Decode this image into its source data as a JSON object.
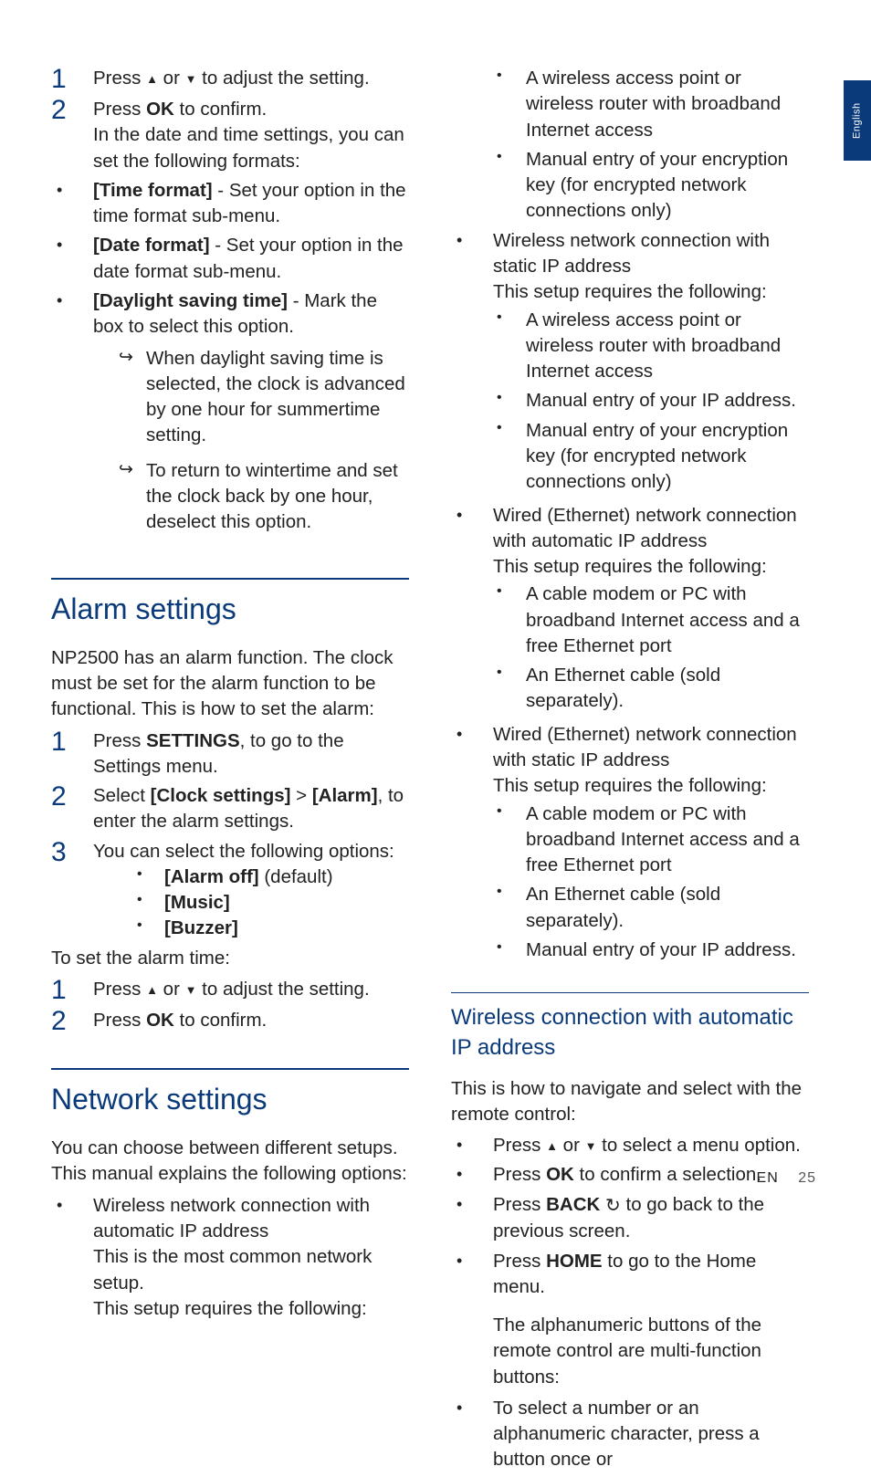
{
  "sideTab": "English",
  "footer": {
    "lang": "EN",
    "page": "25"
  },
  "glyph": {
    "up": "▲",
    "down": "▼",
    "bullet": "•",
    "arrow": "↪",
    "back": "↺"
  },
  "left": {
    "steps1": [
      {
        "n": "1",
        "pre": "Press ",
        "mid": " or ",
        "post": " to adjust the setting."
      },
      {
        "n": "2",
        "pre": "Press ",
        "bold": "OK",
        "post": " to confirm.",
        "extra": "In the date and time settings, you can set the following formats:"
      }
    ],
    "bullets1": [
      {
        "bold": "[Time format]",
        "rest": " - Set your option in the time format sub-menu."
      },
      {
        "bold": "[Date format]",
        "rest": " - Set your option in the date format sub-menu."
      },
      {
        "bold": "[Daylight saving time]",
        "rest": " - Mark the box to select this option.",
        "arrows": [
          "When daylight saving time is selected, the clock is advanced by one hour for summertime setting.",
          "To return to wintertime and set the clock back by one hour, deselect this option."
        ]
      }
    ],
    "alarm": {
      "title": "Alarm settings",
      "intro": "NP2500 has an alarm function. The clock must be set for the alarm function to be functional. This is how to set the alarm:",
      "steps": [
        {
          "n": "1",
          "pre": "Press ",
          "bold": "SETTINGS",
          "post": ", to go to the Settings menu."
        },
        {
          "n": "2",
          "pre": "Select ",
          "bold": "[Clock settings]",
          "mid": " > ",
          "bold2": "[Alarm]",
          "post": ", to enter the alarm settings."
        },
        {
          "n": "3",
          "pre": "You can select the following options:",
          "opts": [
            {
              "b": "[Alarm off]",
              "r": " (default)"
            },
            {
              "b": "[Music]",
              "r": ""
            },
            {
              "b": "[Buzzer]",
              "r": ""
            }
          ]
        }
      ],
      "toset": "To set the alarm time:",
      "steps2": [
        {
          "n": "1",
          "pre": "Press ",
          "mid": " or ",
          "post": " to adjust the setting."
        },
        {
          "n": "2",
          "pre": "Press ",
          "bold": "OK",
          "post": " to confirm."
        }
      ]
    },
    "network": {
      "title": "Network settings",
      "intro": "You can choose between different setups. This manual explains the following options:",
      "item1": {
        "line1": "Wireless network connection with automatic IP address",
        "line2": "This is the most common network setup.",
        "line3": "This setup requires the following:"
      }
    }
  },
  "right": {
    "top_subs": [
      "A wireless access point or wireless router with broadband Internet access",
      "Manual entry of your encryption key (for encrypted network connections only)"
    ],
    "items": [
      {
        "line1": "Wireless network connection with static IP address",
        "req": "This setup requires the following:",
        "subs": [
          "A wireless access point or wireless router with broadband Internet access",
          "Manual entry of your IP address.",
          "Manual entry of your encryption key (for encrypted network connections only)"
        ]
      },
      {
        "line1": "Wired (Ethernet) network connection with automatic IP address",
        "req": "This setup requires the following:",
        "subs": [
          "A cable modem or PC with broadband Internet access and a free Ethernet port",
          "An Ethernet cable (sold separately)."
        ]
      },
      {
        "line1": "Wired (Ethernet) network connection with static IP address",
        "req": "This setup requires the following:",
        "subs": [
          "A cable modem or PC with broadband Internet access and a free Ethernet port",
          "An Ethernet cable (sold separately).",
          "Manual entry of your IP address."
        ]
      }
    ],
    "wireless": {
      "title": "Wireless connection with automatic IP address",
      "intro": "This is how to navigate and select with the remote control:",
      "nav": [
        {
          "pre": "Press ",
          "tri": true,
          "mid": " or ",
          "post": " to select a menu option."
        },
        {
          "pre": "Press ",
          "bold": "OK",
          "post": " to confirm a selection."
        },
        {
          "pre": "Press ",
          "bold": "BACK",
          "icon": "back",
          "post": " to go back to the previous screen."
        },
        {
          "pre": "Press ",
          "bold": "HOME",
          "post": " to go to the Home menu."
        }
      ],
      "note": "The alphanumeric buttons of the remote control are multi-function buttons:",
      "last": "To select a number or an alphanumeric character, press a button once or"
    }
  }
}
